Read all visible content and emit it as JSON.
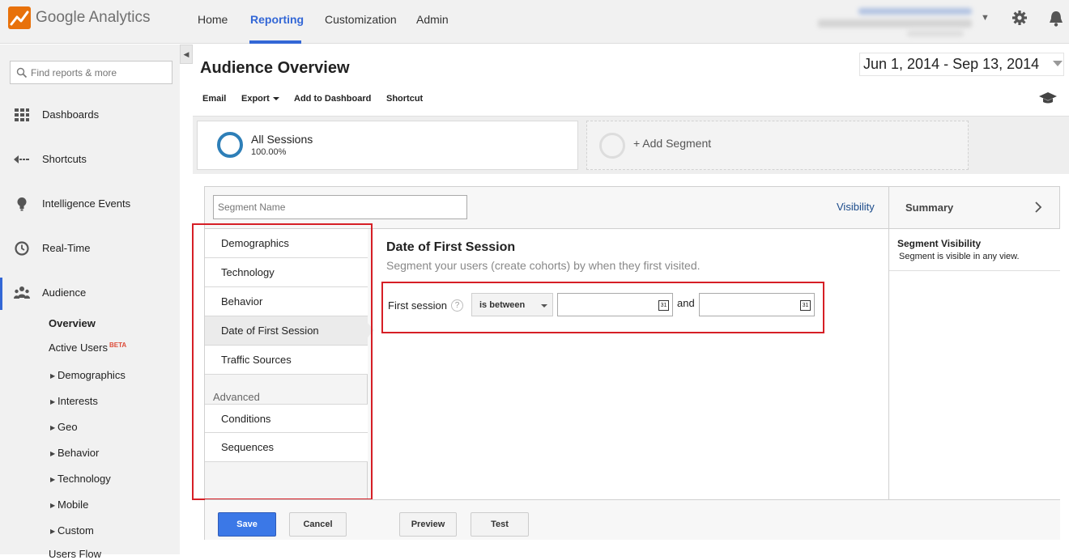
{
  "brand": {
    "name": "Google Analytics"
  },
  "nav": {
    "tabs": [
      "Home",
      "Reporting",
      "Customization",
      "Admin"
    ],
    "active": "Reporting"
  },
  "sidebar": {
    "search_placeholder": "Find reports & more",
    "items": [
      {
        "label": "Dashboards",
        "icon": "grid-icon"
      },
      {
        "label": "Shortcuts",
        "icon": "shortcut-arrow-icon"
      },
      {
        "label": "Intelligence Events",
        "icon": "lightbulb-icon"
      },
      {
        "label": "Real-Time",
        "icon": "clock-icon"
      },
      {
        "label": "Audience",
        "icon": "people-icon"
      }
    ],
    "audience_sub": {
      "overview": "Overview",
      "active_users": "Active Users",
      "beta": "BETA",
      "groups": [
        "Demographics",
        "Interests",
        "Geo",
        "Behavior",
        "Technology",
        "Mobile",
        "Custom"
      ],
      "cut_off": "Users Flow"
    }
  },
  "page": {
    "title": "Audience Overview",
    "date_range": "Jun 1, 2014 - Sep 13, 2014"
  },
  "toolbar": {
    "email": "Email",
    "export": "Export",
    "add_to_dashboard": "Add to Dashboard",
    "shortcut": "Shortcut"
  },
  "segments": {
    "active": {
      "name": "All Sessions",
      "pct": "100.00%"
    },
    "add_label": "+ Add Segment"
  },
  "editor": {
    "name_placeholder": "Segment Name",
    "visibility_link": "Visibility",
    "summary": "Summary",
    "nav": [
      "Demographics",
      "Technology",
      "Behavior",
      "Date of First Session",
      "Traffic Sources"
    ],
    "selected": "Date of First Session",
    "advanced_label": "Advanced",
    "advanced": [
      "Conditions",
      "Sequences"
    ],
    "content_title": "Date of First Session",
    "content_subtitle": "Segment your users (create cohorts) by when they first visited.",
    "condition": {
      "label": "First session",
      "help": "?",
      "operator": "is between",
      "and": "and",
      "cal_day": "31"
    },
    "visibility_title": "Segment Visibility",
    "visibility_desc": "Segment is visible in any view.",
    "buttons": {
      "save": "Save",
      "cancel": "Cancel",
      "preview": "Preview",
      "test": "Test"
    }
  },
  "colors": {
    "accent": "#3367d6",
    "highlight_red": "#d61f26",
    "save_blue": "#3b78e7"
  }
}
